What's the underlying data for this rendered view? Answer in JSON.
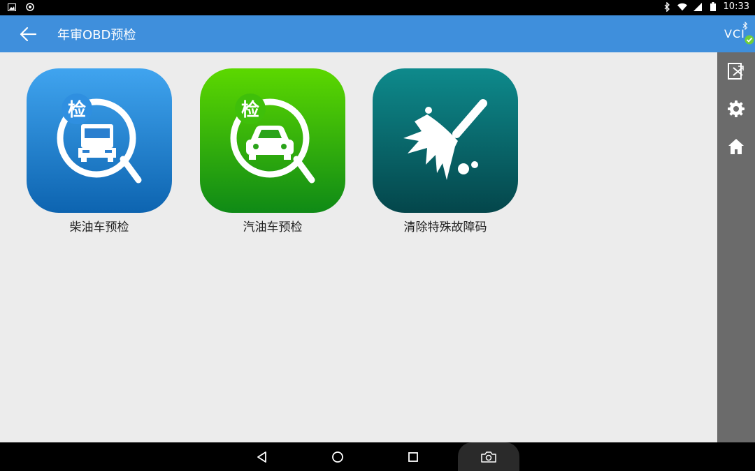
{
  "status_bar": {
    "time": "10:33",
    "icons": [
      "image-icon",
      "shield-icon",
      "bluetooth-icon",
      "wifi-icon",
      "signal-icon",
      "battery-icon"
    ]
  },
  "app_bar": {
    "title": "年审OBD预检",
    "color": "#3f8fdc"
  },
  "side_panel": {
    "vci_label": "VCI",
    "buttons": [
      "exit-icon",
      "gear-icon",
      "home-icon"
    ]
  },
  "tiles": [
    {
      "label": "柴油车预检",
      "badge": "检",
      "icon": "truck-magnifier-icon"
    },
    {
      "label": "汽油车预检",
      "badge": "检",
      "icon": "car-magnifier-icon"
    },
    {
      "label": "清除特殊故障码",
      "icon": "broom-icon"
    }
  ],
  "nav_bar": {
    "buttons": [
      "back-triangle-icon",
      "home-circle-icon",
      "recents-square-icon",
      "camera-icon"
    ]
  }
}
